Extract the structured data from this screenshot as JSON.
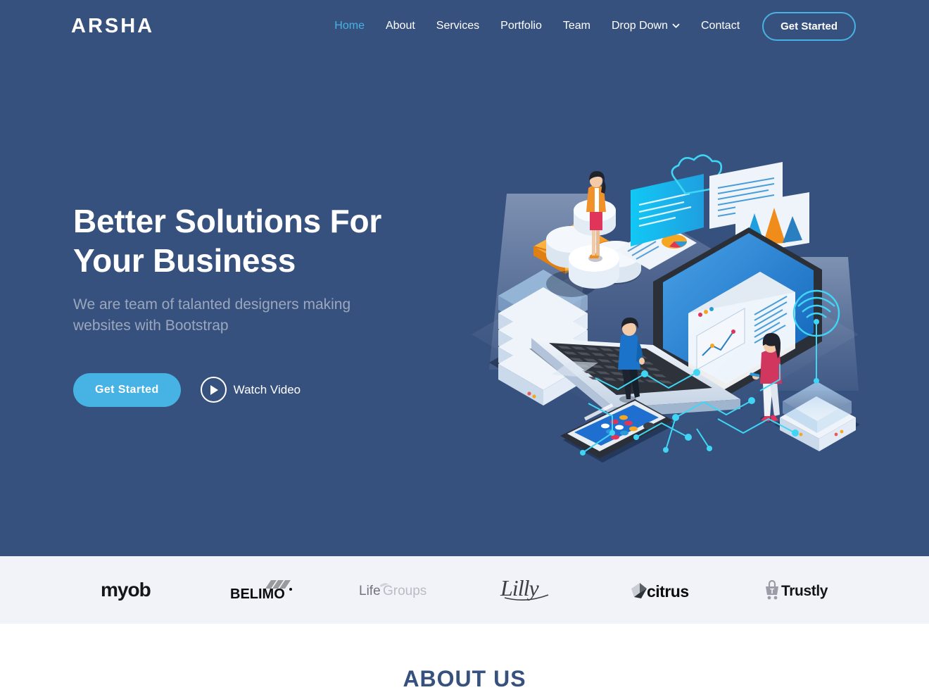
{
  "brand": {
    "name": "ARSHA"
  },
  "colors": {
    "hero_bg": "#37517e",
    "accent": "#47b2e4",
    "clients_bg": "#f1f3f8",
    "heading": "#37517e",
    "muted_text": "#9aa7bd"
  },
  "nav": {
    "items": [
      {
        "label": "Home",
        "active": true,
        "dropdown": false
      },
      {
        "label": "About",
        "active": false,
        "dropdown": false
      },
      {
        "label": "Services",
        "active": false,
        "dropdown": false
      },
      {
        "label": "Portfolio",
        "active": false,
        "dropdown": false
      },
      {
        "label": "Team",
        "active": false,
        "dropdown": false
      },
      {
        "label": "Drop Down",
        "active": false,
        "dropdown": true
      },
      {
        "label": "Contact",
        "active": false,
        "dropdown": false
      }
    ],
    "cta_label": "Get Started"
  },
  "hero": {
    "title_line1": "Better Solutions For",
    "title_line2": "Your Business",
    "subtitle": "We are team of talanted designers making websites with Bootstrap",
    "primary_button": "Get Started",
    "video_button": "Watch Video",
    "illustration_alt": "isometric-digital-workspace-illustration"
  },
  "clients": [
    {
      "name": "myob",
      "logo": "myob-logo"
    },
    {
      "name": "BELIMO",
      "logo": "belimo-logo"
    },
    {
      "name": "LifeGroups",
      "logo": "lifegroups-logo"
    },
    {
      "name": "Lilly",
      "logo": "lilly-logo"
    },
    {
      "name": "citrus",
      "logo": "citrus-logo"
    },
    {
      "name": "Trustly",
      "logo": "trustly-logo"
    }
  ],
  "about": {
    "section_title": "ABOUT US"
  }
}
